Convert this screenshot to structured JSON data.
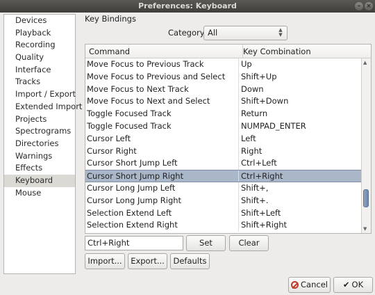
{
  "window": {
    "title": "Preferences: Keyboard"
  },
  "sidebar": {
    "items": [
      {
        "label": "Devices"
      },
      {
        "label": "Playback"
      },
      {
        "label": "Recording"
      },
      {
        "label": "Quality"
      },
      {
        "label": "Interface"
      },
      {
        "label": "Tracks"
      },
      {
        "label": "Import / Export"
      },
      {
        "label": "Extended Import"
      },
      {
        "label": "Projects"
      },
      {
        "label": "Spectrograms"
      },
      {
        "label": "Directories"
      },
      {
        "label": "Warnings"
      },
      {
        "label": "Effects"
      },
      {
        "label": "Keyboard",
        "selected": true
      },
      {
        "label": "Mouse"
      }
    ]
  },
  "group": {
    "label": "Key Bindings"
  },
  "category": {
    "label": "Category:",
    "value": "All"
  },
  "table": {
    "columns": {
      "command": "Command",
      "key": "Key Combination"
    },
    "rows": [
      {
        "command": "Move Focus to Previous Track",
        "key": "Up"
      },
      {
        "command": "Move Focus to Previous and Select",
        "key": "Shift+Up"
      },
      {
        "command": "Move Focus to Next Track",
        "key": "Down"
      },
      {
        "command": "Move Focus to Next and Select",
        "key": "Shift+Down"
      },
      {
        "command": "Toggle Focused Track",
        "key": "Return"
      },
      {
        "command": "Toggle Focused Track",
        "key": "NUMPAD_ENTER"
      },
      {
        "command": "Cursor Left",
        "key": "Left"
      },
      {
        "command": "Cursor Right",
        "key": "Right"
      },
      {
        "command": "Cursor Short Jump Left",
        "key": "Ctrl+Left"
      },
      {
        "command": "Cursor Short Jump Right",
        "key": "Ctrl+Right",
        "selected": true
      },
      {
        "command": "Cursor Long Jump Left",
        "key": "Shift+,"
      },
      {
        "command": "Cursor Long Jump Right",
        "key": "Shift+."
      },
      {
        "command": "Selection Extend Left",
        "key": "Shift+Left"
      },
      {
        "command": "Selection Extend Right",
        "key": "Shift+Right"
      }
    ]
  },
  "key_input": {
    "value": "Ctrl+Right"
  },
  "buttons": {
    "set": "Set",
    "clear": "Clear",
    "import": "Import...",
    "export": "Export...",
    "defaults": "Defaults",
    "cancel": "Cancel",
    "ok": "OK"
  }
}
